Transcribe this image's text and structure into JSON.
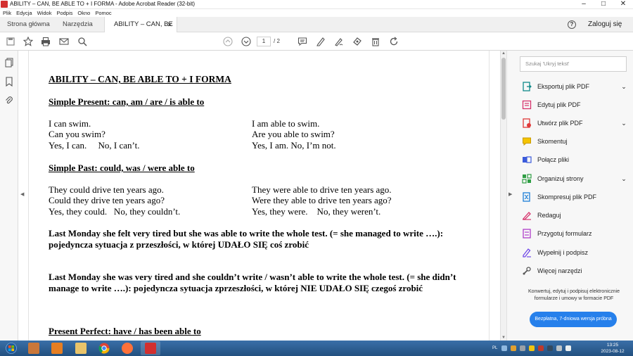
{
  "window": {
    "title": "ABILITY – CAN, BE ABLE TO + I FORMA - Adobe Acrobat Reader (32-bit)"
  },
  "menu": [
    "Plik",
    "Edycja",
    "Widok",
    "Podpis",
    "Okno",
    "Pomoc"
  ],
  "tabs": {
    "home": "Strona główna",
    "tools": "Narzędzia",
    "document": "ABILITY – CAN, BE ...",
    "login": "Zaloguj się"
  },
  "toolbar": {
    "current_page": "1",
    "total_pages": "/ 2"
  },
  "document": {
    "heading": "ABILITY – CAN, BE ABLE TO + I FORMA",
    "present_heading": "Simple Present: can, am / are / is able to",
    "present_left": [
      "I can swim.",
      "Can you swim?",
      "Yes, I can.     No, I can’t."
    ],
    "present_right": [
      "I am able to swim.",
      "Are you able to swim?",
      "Yes, I am. No, I’m not."
    ],
    "past_heading": "Simple Past: could, was / were able to",
    "past_left": [
      "They could drive ten years ago.",
      "Could they drive ten years ago?",
      "Yes, they could.   No, they couldn’t."
    ],
    "past_right": [
      "They were able to drive ten years ago.",
      "Were they able to drive ten years ago?",
      "Yes, they were.    No, they weren’t."
    ],
    "para1_line1": "Last Monday she felt very tired but she was able to write the whole test. (= she managed to write ….):",
    "para1_line2": "pojedyncza sytuacja z przeszłości, w której UDAŁO SIĘ coś zrobić",
    "para2_line1": "Last Monday she was very tired and she couldn’t write / wasn’t able to write the whole test. (= she didn’t",
    "para2_line2": "manage to write ….): pojedyncza sytuacja zprzeszłości, w której NIE UDAŁO SIĘ czegoś zrobić",
    "perfect_heading": "Present Perfect: have / has been able to"
  },
  "right_pane": {
    "search_placeholder": "Szukaj 'Ukryj tekst'",
    "tools": [
      {
        "label": "Eksportuj plik PDF",
        "icon": "export-pdf-icon",
        "color": "#0f8a8a",
        "expand": true
      },
      {
        "label": "Edytuj plik PDF",
        "icon": "edit-pdf-icon",
        "color": "#d6336c",
        "expand": false
      },
      {
        "label": "Utwórz plik PDF",
        "icon": "create-pdf-icon",
        "color": "#e03a3a",
        "expand": true
      },
      {
        "label": "Skomentuj",
        "icon": "comment-icon",
        "color": "#e8b400",
        "expand": false
      },
      {
        "label": "Połącz pliki",
        "icon": "combine-files-icon",
        "color": "#3b5bdb",
        "expand": false
      },
      {
        "label": "Organizuj strony",
        "icon": "organize-pages-icon",
        "color": "#2f9e44",
        "expand": true
      },
      {
        "label": "Skompresuj plik PDF",
        "icon": "compress-pdf-icon",
        "color": "#1c7ed6",
        "expand": false
      },
      {
        "label": "Redaguj",
        "icon": "redact-icon",
        "color": "#d6336c",
        "expand": false
      },
      {
        "label": "Przygotuj formularz",
        "icon": "prepare-form-icon",
        "color": "#ae3ec9",
        "expand": false
      },
      {
        "label": "Wypełnij i podpisz",
        "icon": "fill-sign-icon",
        "color": "#7048e8",
        "expand": false
      },
      {
        "label": "Więcej narzędzi",
        "icon": "more-tools-icon",
        "color": "#555555",
        "expand": false
      }
    ],
    "promo_text": "Konwertuj, edytuj i podpisuj elektronicznie formularze i umowy w formacie PDF",
    "trial_button": "Bezpłatna, 7-dniowa wersja próbna"
  },
  "taskbar": {
    "language": "PL",
    "time": "13:25",
    "date": "2023-08-12"
  },
  "colors": {
    "accent": "#2680eb",
    "taskbar": "#2a5d92"
  }
}
